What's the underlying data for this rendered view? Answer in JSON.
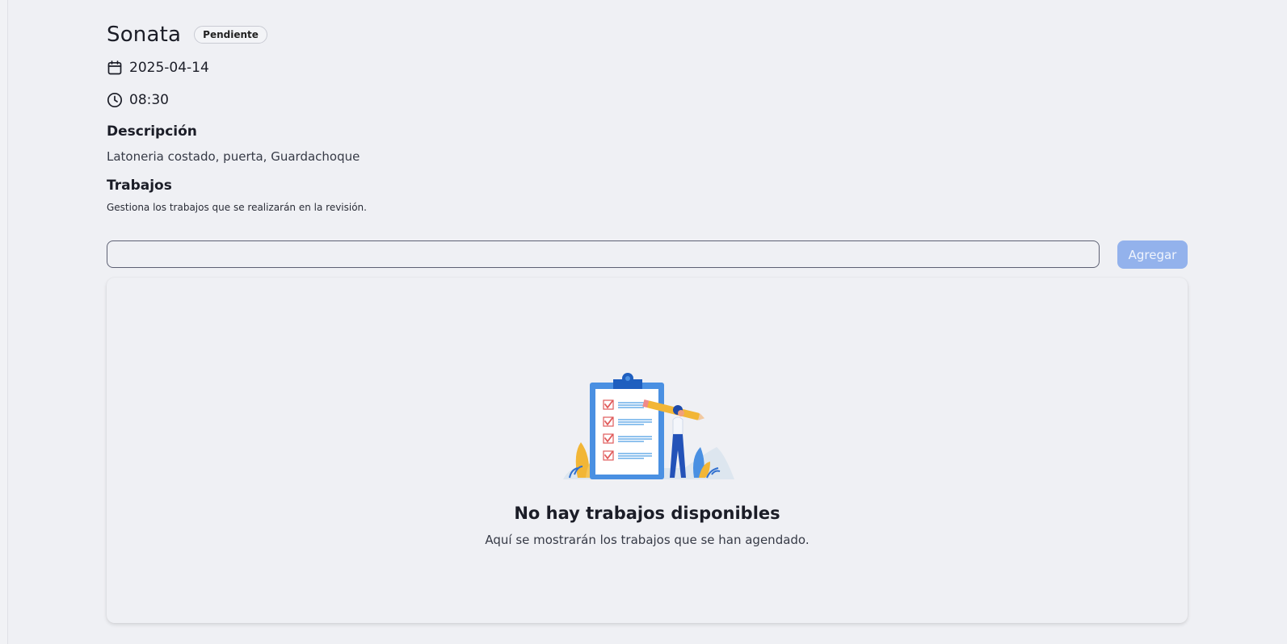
{
  "header": {
    "title": "Sonata",
    "status": "Pendiente"
  },
  "meta": {
    "date": "2025-04-14",
    "date_icon": "calendar-icon",
    "time": "08:30",
    "time_icon": "clock-icon"
  },
  "description": {
    "title": "Descripción",
    "text": "Latoneria costado, puerta, Guardachoque"
  },
  "jobs": {
    "title": "Trabajos",
    "subtitle": "Gestiona los trabajos que se realizarán en la revisión.",
    "input_value": "",
    "add_label": "Agregar",
    "empty_icon": "clipboard-checklist-illustration",
    "empty_title": "No hay trabajos disponibles",
    "empty_subtitle": "Aquí se mostrarán los trabajos que se han agendado."
  },
  "colors": {
    "background": "#eff0f4",
    "accent_disabled": "#93b2ec",
    "text": "#1b1d27"
  }
}
